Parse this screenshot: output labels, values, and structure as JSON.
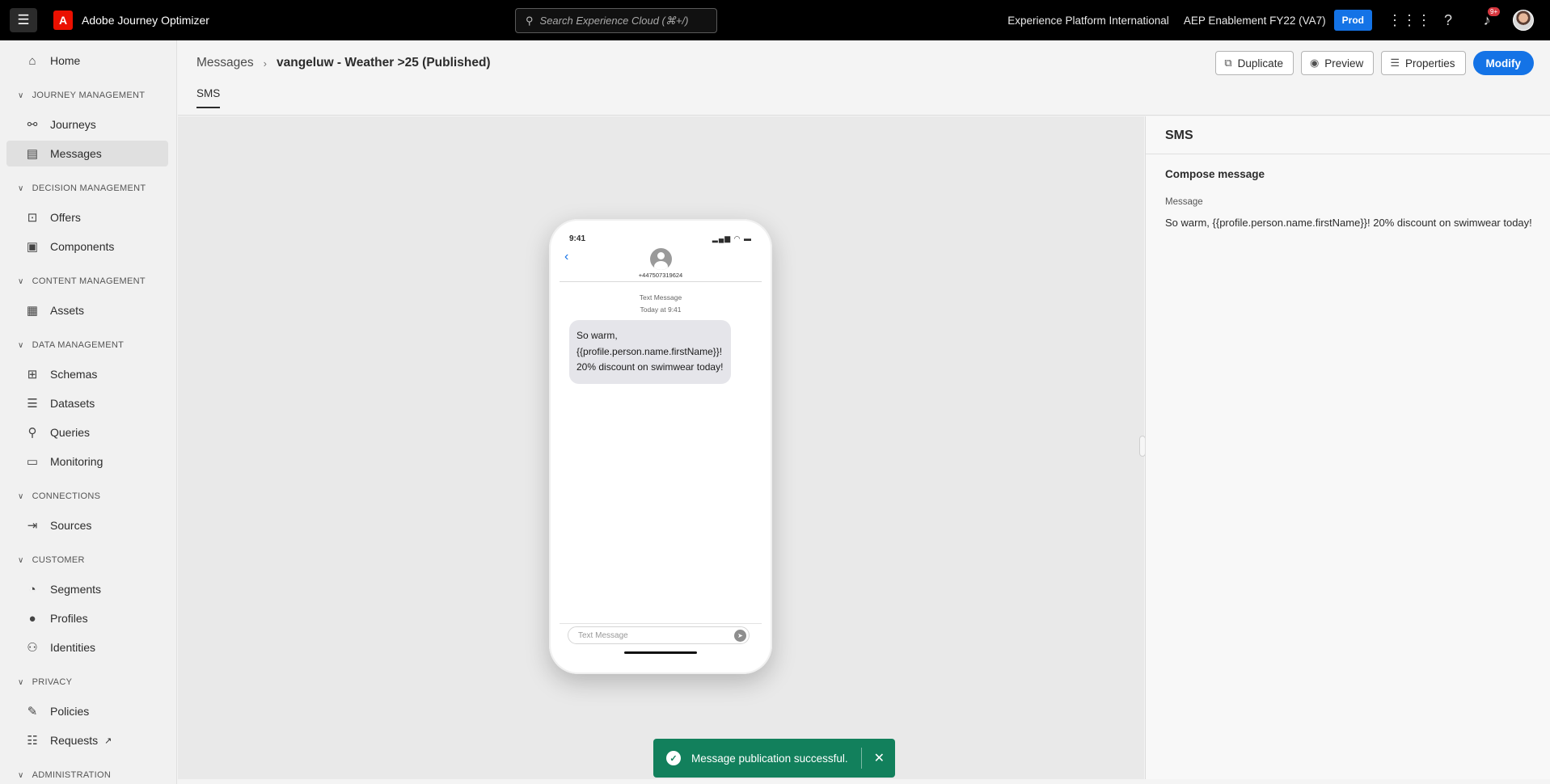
{
  "topbar": {
    "app_title": "Adobe Journey Optimizer",
    "search_placeholder": "Search Experience Cloud (⌘+/)",
    "org": "Experience Platform International",
    "sandbox": "AEP Enablement FY22 (VA7)",
    "env_badge": "Prod",
    "notification_count": "9+"
  },
  "sidebar": {
    "home": "Home",
    "sections": {
      "journey_management": "JOURNEY MANAGEMENT",
      "decision_management": "DECISION MANAGEMENT",
      "content_management": "CONTENT MANAGEMENT",
      "data_management": "DATA MANAGEMENT",
      "connections": "CONNECTIONS",
      "customer": "CUSTOMER",
      "privacy": "PRIVACY",
      "administration": "ADMINISTRATION"
    },
    "items": {
      "journeys": "Journeys",
      "messages": "Messages",
      "offers": "Offers",
      "components": "Components",
      "assets": "Assets",
      "schemas": "Schemas",
      "datasets": "Datasets",
      "queries": "Queries",
      "monitoring": "Monitoring",
      "sources": "Sources",
      "segments": "Segments",
      "profiles": "Profiles",
      "identities": "Identities",
      "policies": "Policies",
      "requests": "Requests"
    },
    "active": "Messages"
  },
  "header": {
    "breadcrumb_parent": "Messages",
    "breadcrumb_current": "vangeluw - Weather >25 (Published)",
    "tab": "SMS",
    "buttons": {
      "duplicate": "Duplicate",
      "preview": "Preview",
      "properties": "Properties",
      "modify": "Modify"
    }
  },
  "phone": {
    "time": "9:41",
    "contact_number": "+447507319624",
    "meta_line1": "Text Message",
    "meta_line2": "Today at 9:41",
    "message": "So warm, {{profile.person.name.firstName}}! 20% discount on swimwear today!",
    "composer_placeholder": "Text Message"
  },
  "panel": {
    "title": "SMS",
    "compose_title": "Compose message",
    "field_label": "Message",
    "field_value": "So warm, {{profile.person.name.firstName}}! 20% discount on swimwear today!"
  },
  "toast": {
    "text": "Message publication successful."
  },
  "colors": {
    "accent": "#1473e6",
    "toast": "#12805c",
    "brand": "#eb1000"
  }
}
